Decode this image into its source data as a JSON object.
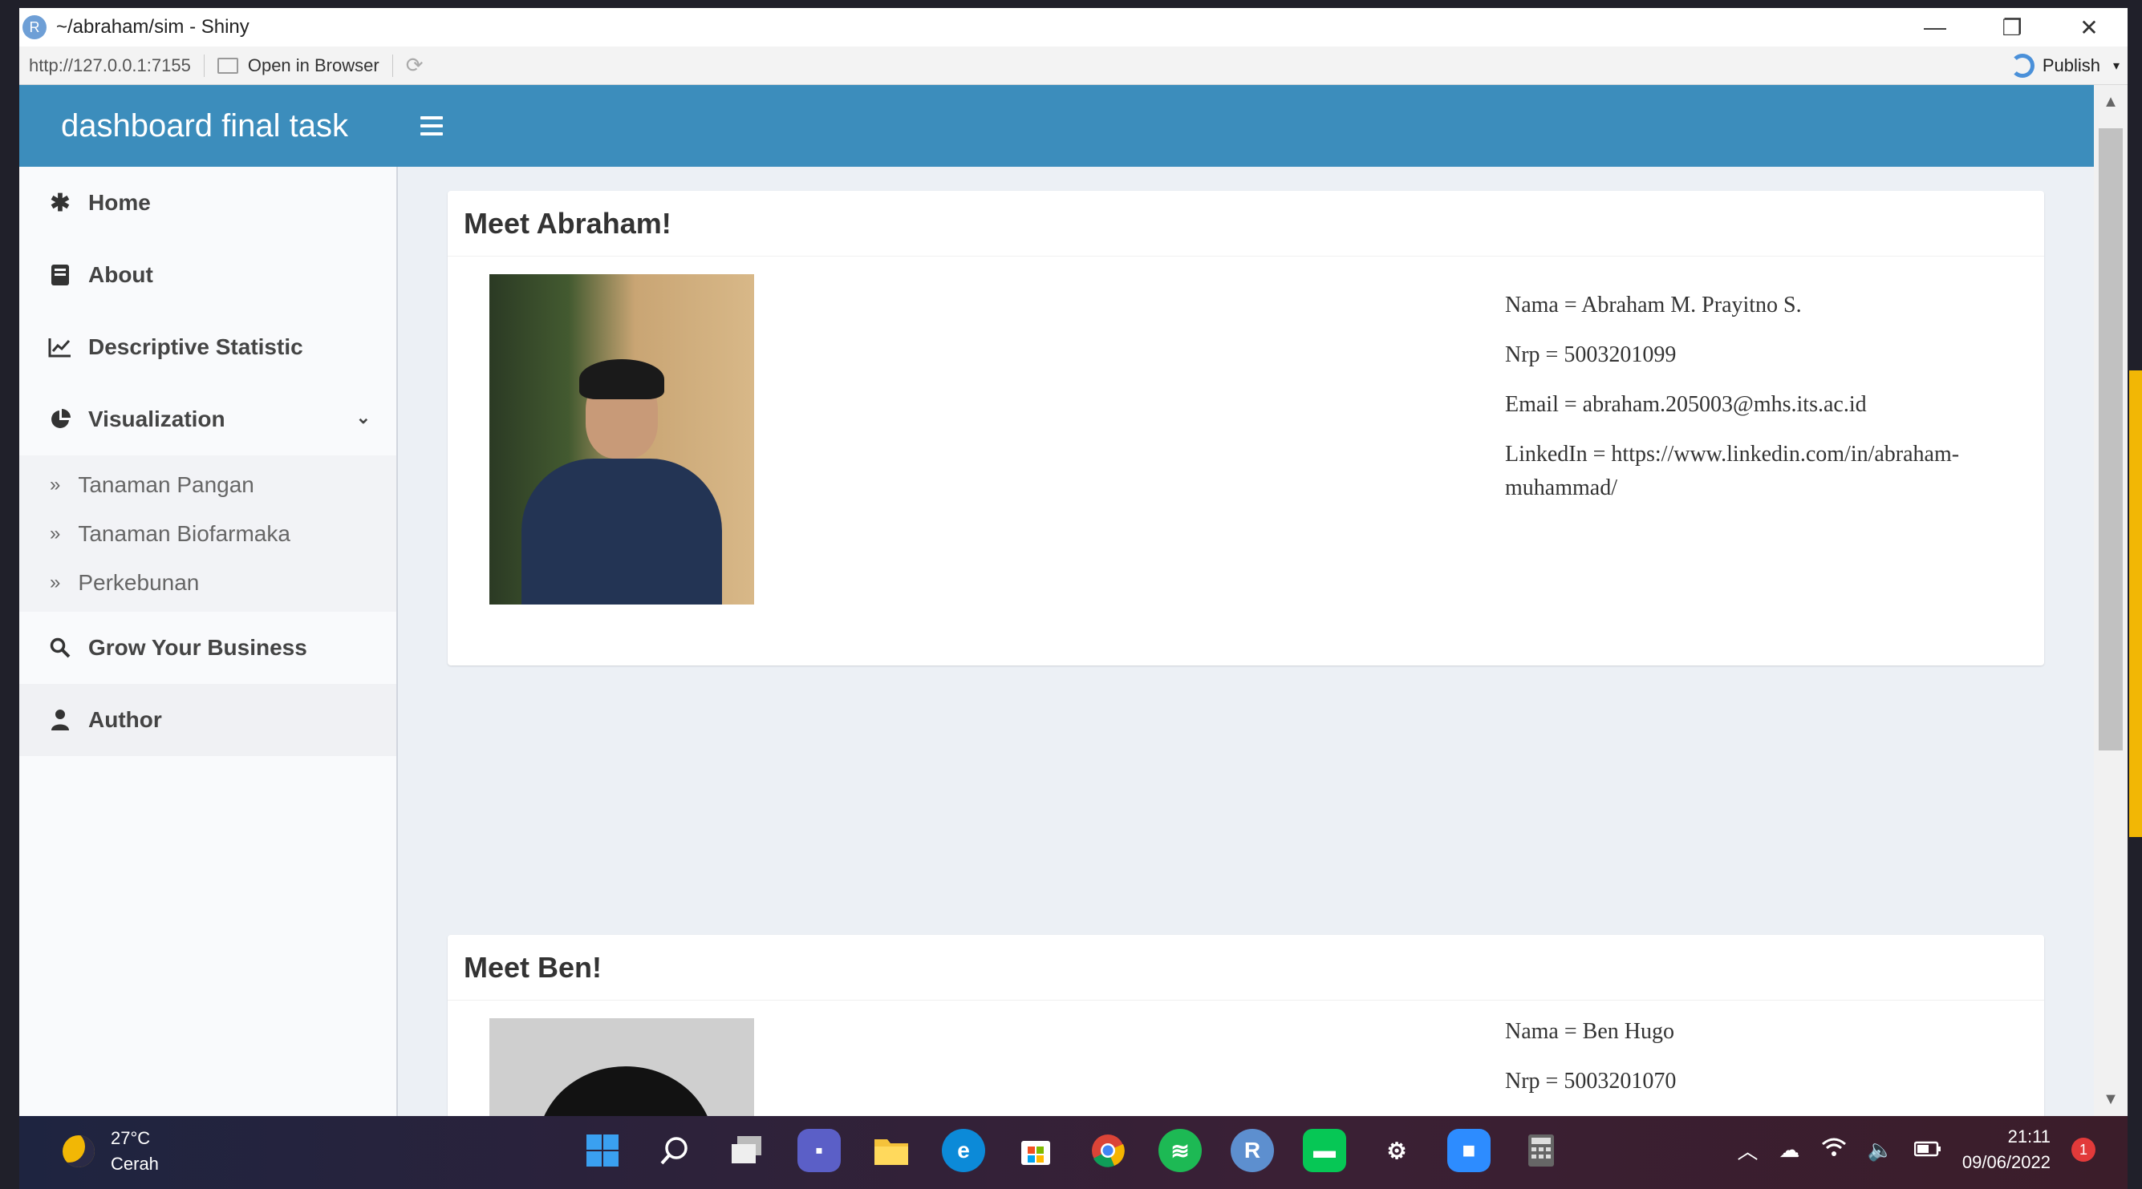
{
  "window": {
    "title": "~/abraham/sim - Shiny",
    "logo_letter": "R",
    "minimize": "—",
    "maximize": "❐",
    "close": "✕"
  },
  "toolbar": {
    "url": "http://127.0.0.1:7155",
    "open_in_browser": "Open in Browser",
    "publish": "Publish"
  },
  "app": {
    "title": "dashboard final task"
  },
  "sidebar": {
    "items": [
      {
        "label": "Home",
        "icon": "asterisk-icon"
      },
      {
        "label": "About",
        "icon": "book-icon"
      },
      {
        "label": "Descriptive Statistic",
        "icon": "chart-line-icon"
      },
      {
        "label": "Visualization",
        "icon": "pie-chart-icon"
      },
      {
        "label": "Grow Your Business",
        "icon": "search-icon"
      },
      {
        "label": "Author",
        "icon": "user-icon"
      }
    ],
    "sub_items": [
      {
        "label": "Tanaman Pangan"
      },
      {
        "label": "Tanaman Biofarmaka"
      },
      {
        "label": "Perkebunan"
      }
    ]
  },
  "authors": [
    {
      "heading": "Meet Abraham!",
      "nama": "Nama = Abraham M. Prayitno S.",
      "nrp": "Nrp = 5003201099",
      "email": "Email = abraham.205003@mhs.its.ac.id",
      "linkedin": "LinkedIn = https://www.linkedin.com/in/abraham-muhammad/"
    },
    {
      "heading": "Meet Ben!",
      "nama": "Nama = Ben Hugo",
      "nrp": "Nrp = 5003201070"
    }
  ],
  "taskbar": {
    "temperature": "27°C",
    "weather": "Cerah",
    "time": "21:11",
    "date": "09/06/2022",
    "notifications": "1",
    "r_app": "R"
  },
  "colors": {
    "header": "#3c8dbc",
    "sidebar": "#f9fafc",
    "content_bg": "#ecf0f5"
  }
}
